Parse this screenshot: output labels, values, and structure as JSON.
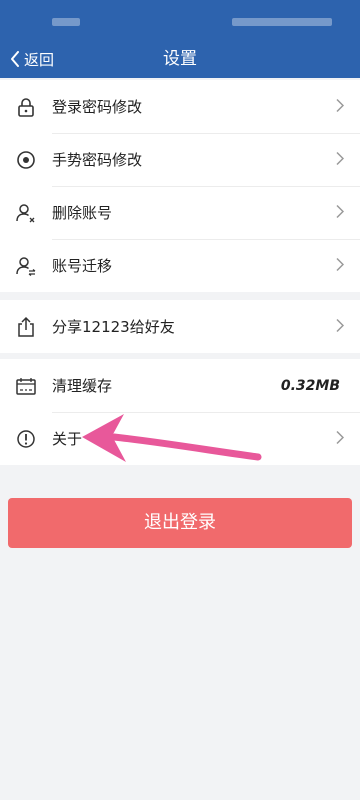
{
  "nav": {
    "back_label": "返回",
    "title": "设置"
  },
  "groups": [
    {
      "items": [
        {
          "label": "登录密码修改",
          "icon": "lock-icon"
        },
        {
          "label": "手势密码修改",
          "icon": "gesture-icon"
        },
        {
          "label": "删除账号",
          "icon": "user-delete-icon"
        },
        {
          "label": "账号迁移",
          "icon": "user-transfer-icon"
        }
      ]
    },
    {
      "items": [
        {
          "label": "分享12123给好友",
          "icon": "share-icon"
        }
      ]
    },
    {
      "items": [
        {
          "label": "清理缓存",
          "icon": "cache-icon",
          "value": "0.32MB"
        },
        {
          "label": "关于",
          "icon": "info-icon"
        }
      ]
    }
  ],
  "logout": {
    "label": "退出登录"
  },
  "colors": {
    "header": "#2d63ae",
    "logout": "#f16a6c",
    "annotation_arrow": "#e8589a"
  }
}
